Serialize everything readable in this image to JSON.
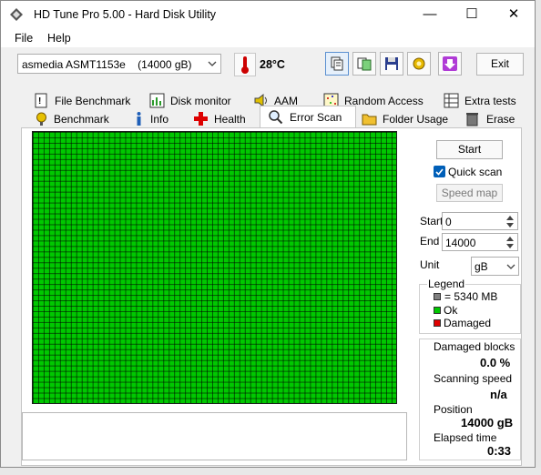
{
  "window": {
    "title": "HD Tune Pro 5.00 - Hard Disk Utility",
    "controls": [
      "—",
      "☐",
      "✕"
    ]
  },
  "menu": {
    "file": "File",
    "help": "Help"
  },
  "toolbar": {
    "drive": "asmedia ASMT1153e    (14000 gB)",
    "temperature": "28°C",
    "exit_label": "Exit",
    "icons": [
      "copy-info-icon",
      "copy-screen-icon",
      "save-icon",
      "options-icon",
      "download-icon"
    ]
  },
  "tabs": {
    "row1": [
      "File Benchmark",
      "Disk monitor",
      "AAM",
      "Random Access",
      "Extra tests"
    ],
    "row2": [
      "Benchmark",
      "Info",
      "Health",
      "Error Scan",
      "Folder Usage",
      "Erase"
    ],
    "active": "Error Scan"
  },
  "scan": {
    "start_button": "Start",
    "quick_scan": {
      "label": "Quick scan",
      "checked": true
    },
    "speed_map_button": "Speed map",
    "start_label": "Start",
    "start_value": "0",
    "end_label": "End",
    "end_value": "14000",
    "unit_label": "Unit",
    "unit_value": "gB",
    "grid_colors": {
      "ok": "#00c800"
    }
  },
  "legend": {
    "title": "Legend",
    "items": [
      {
        "label": "= 5340 MB",
        "color": "#808080"
      },
      {
        "label": "Ok",
        "color": "#00c800"
      },
      {
        "label": "Damaged",
        "color": "#e00000"
      }
    ]
  },
  "stats": {
    "damaged_label": "Damaged blocks",
    "damaged_value": "0.0 %",
    "speed_label": "Scanning speed",
    "speed_value": "n/a",
    "position_label": "Position",
    "position_value": "14000 gB",
    "elapsed_label": "Elapsed time",
    "elapsed_value": "0:33"
  }
}
